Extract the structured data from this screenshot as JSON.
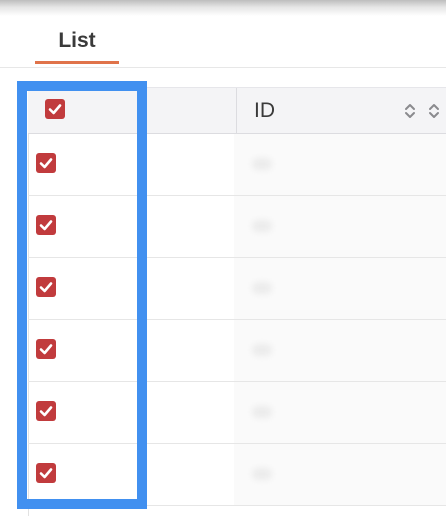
{
  "tabs": [
    {
      "label": "List",
      "active": true
    }
  ],
  "table": {
    "columns": [
      {
        "key": "select",
        "label": "",
        "checked": true
      },
      {
        "key": "id",
        "label": "ID",
        "sortable": true
      }
    ],
    "rows": [
      {
        "checked": true
      },
      {
        "checked": true
      },
      {
        "checked": true
      },
      {
        "checked": true
      },
      {
        "checked": true
      },
      {
        "checked": true
      }
    ]
  },
  "colors": {
    "accent_tab": "#e0734a",
    "checkbox": "#c13b3d",
    "highlight": "#4190f0"
  },
  "icons": {
    "checkbox": "check-icon",
    "sort": "sort-up-down-icon"
  }
}
